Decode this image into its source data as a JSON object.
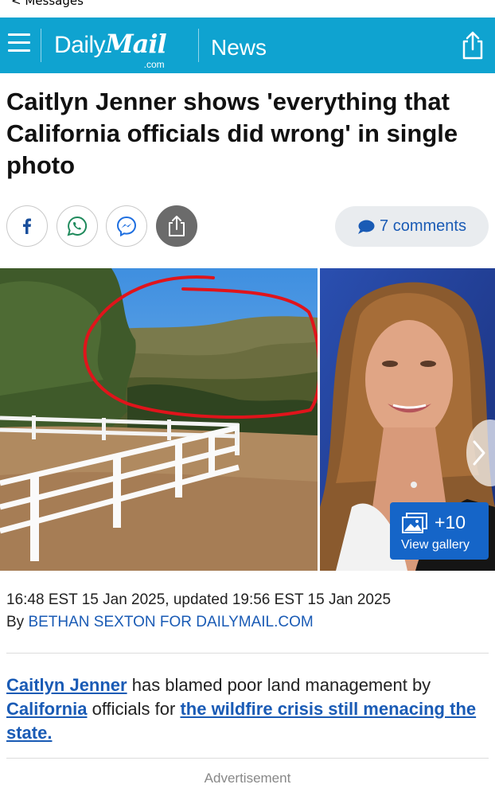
{
  "status": {
    "back_label": "< Messages"
  },
  "header": {
    "brand_daily": "Daily",
    "brand_mail": "Mail",
    "brand_com": ".com",
    "section": "News",
    "menu_icon": "hamburger-icon",
    "share_icon": "share-icon",
    "header_color": "#0fa3d0"
  },
  "article": {
    "headline": "Caitlyn Jenner shows 'everything that California officials did wrong' in single photo",
    "share_buttons": [
      {
        "name": "facebook",
        "icon": "facebook-icon"
      },
      {
        "name": "whatsapp",
        "icon": "whatsapp-icon"
      },
      {
        "name": "messenger",
        "icon": "messenger-icon"
      },
      {
        "name": "share",
        "icon": "share-icon"
      }
    ],
    "comments_label": "7 comments",
    "gallery": {
      "count_label": "+10",
      "view_label": "View gallery"
    },
    "dateline": "16:48 EST 15 Jan 2025, updated 19:56 EST 15 Jan 2025",
    "byline_prefix": "By ",
    "byline_author": "BETHAN SEXTON FOR DAILYMAIL.COM",
    "lede": {
      "link1": "Caitlyn Jenner",
      "text1": " has blamed poor land management by ",
      "link2": "California",
      "text2": " officials for ",
      "link3": "the wildfire crisis still menacing the state."
    },
    "advertisement_label": "Advertisement"
  },
  "colors": {
    "accent_blue": "#1a5bb5",
    "gallery_blue": "#1565c8"
  }
}
